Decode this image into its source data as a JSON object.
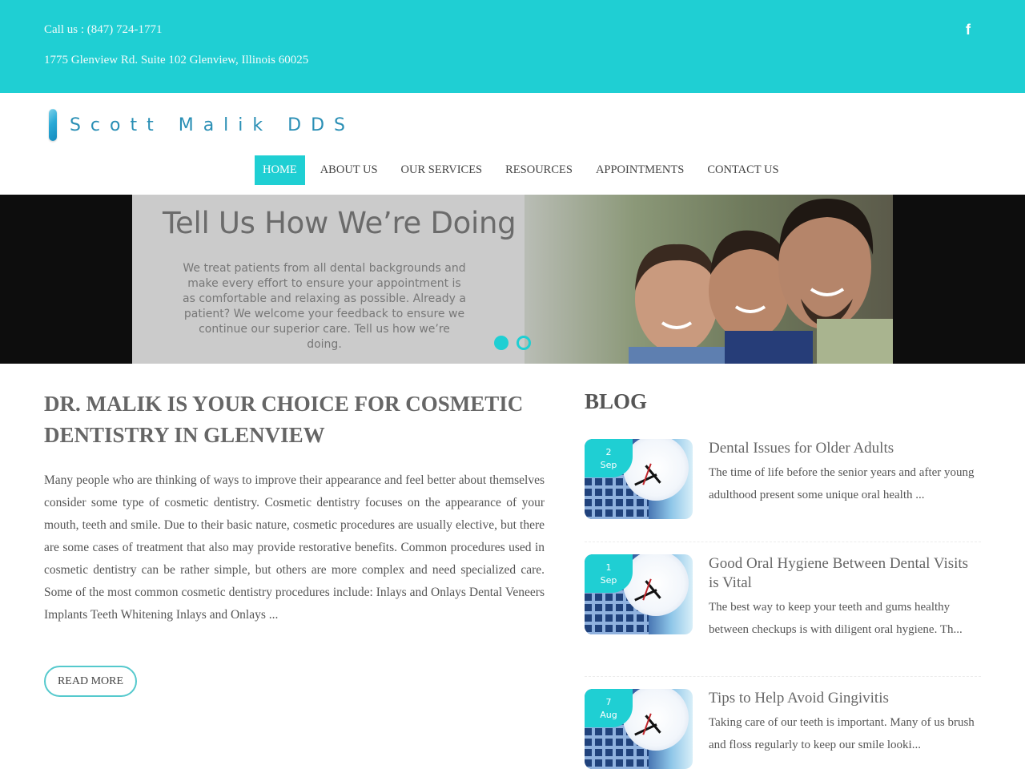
{
  "topbar": {
    "phone": "Call us : (847) 724-1771",
    "address": "1775 Glenview Rd. Suite 102 Glenview, Illinois 60025",
    "social_icon": "facebook-icon",
    "social_glyph": "f"
  },
  "header": {
    "logo_text": "Scott Malik DDS",
    "nav": [
      {
        "label": "HOME",
        "active": true
      },
      {
        "label": "ABOUT US",
        "active": false
      },
      {
        "label": "OUR SERVICES",
        "active": false
      },
      {
        "label": "RESOURCES",
        "active": false
      },
      {
        "label": "APPOINTMENTS",
        "active": false
      },
      {
        "label": "CONTACT US",
        "active": false
      }
    ]
  },
  "hero": {
    "title": "Tell Us How We’re Doing",
    "body": "We treat patients from all dental backgrounds and make every effort to ensure your appointment is as comfortable and relaxing as possible. Already a patient? We welcome your feedback to ensure we continue our superior care. Tell us how we’re doing.",
    "slides_total": 2,
    "active_slide": 1
  },
  "main": {
    "title": "DR. MALIK IS YOUR CHOICE FOR COSMETIC DENTISTRY IN GLENVIEW",
    "body": "Many people who are thinking of ways to improve their appearance and feel better about themselves consider some type of cosmetic dentistry. Cosmetic dentistry focuses on the appearance of your mouth, teeth and smile. Due to their basic nature, cosmetic procedures are usually elective, but there are some cases of treatment that also may provide restorative benefits. Common procedures used in cosmetic dentistry can be rather simple, but others are more complex and need specialized care. Some of the most common cosmetic dentistry procedures include: Inlays and Onlays Dental Veneers Implants Teeth Whitening Inlays and Onlays ...",
    "read_more": "READ MORE"
  },
  "blog": {
    "title": "BLOG",
    "posts": [
      {
        "day": "2",
        "month": "Sep",
        "title": "Dental Issues for Older Adults",
        "excerpt": "The time of life before the senior years and after young adulthood present some unique oral health ..."
      },
      {
        "day": "1",
        "month": "Sep",
        "title": "Good Oral Hygiene Between Dental Visits is Vital",
        "excerpt": "The best way to keep your teeth and gums healthy between checkups is with diligent oral hygiene. Th..."
      },
      {
        "day": "7",
        "month": "Aug",
        "title": "Tips to Help Avoid Gingivitis",
        "excerpt": "Taking care of our teeth is important. Many of us brush and floss regularly to keep our smile looki..."
      }
    ]
  },
  "colors": {
    "accent": "#1fcfd3",
    "text": "#555555",
    "hero_bg": "#0d0d0d"
  }
}
